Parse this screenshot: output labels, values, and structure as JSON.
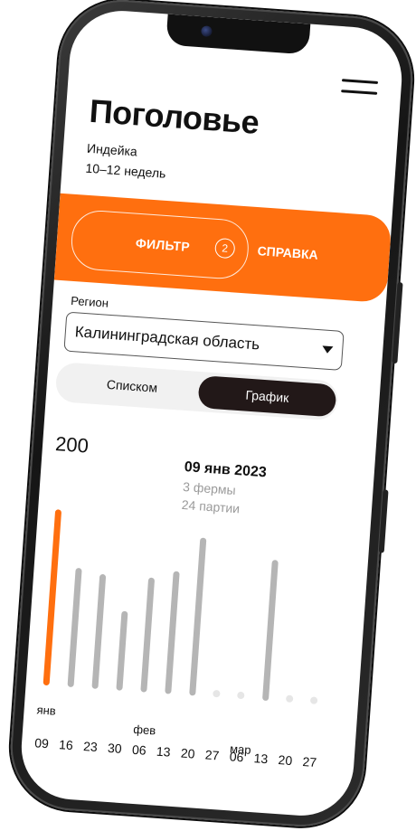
{
  "page": {
    "title": "Поголовье",
    "animal": "Индейка",
    "age": "10–12 недель"
  },
  "tabs": {
    "filter_label": "ФИЛЬТР",
    "filter_count": "2",
    "help_label": "СПРАВКА"
  },
  "region": {
    "label": "Регион",
    "value": "Калининградская область"
  },
  "view_toggle": {
    "list_label": "Списком",
    "chart_label": "График",
    "active": "График"
  },
  "selected_info": {
    "date": "09 янв 2023",
    "farms": "3 фермы",
    "parties": "24 партии"
  },
  "colors": {
    "accent": "#ff6f0f",
    "bar": "#b5b5b5",
    "dot": "#e6e6e6",
    "dark": "#221818"
  },
  "chart_data": {
    "type": "bar",
    "ymax_label": "200",
    "ylim": [
      0,
      200
    ],
    "categories": [
      "09",
      "16",
      "23",
      "30",
      "06",
      "13",
      "20",
      "27",
      "06",
      "13",
      "20",
      "27"
    ],
    "months": [
      {
        "label": "янв",
        "start_index": 0
      },
      {
        "label": "фев",
        "start_index": 4
      },
      {
        "label": "мар",
        "start_index": 8
      }
    ],
    "values": [
      200,
      135,
      130,
      90,
      130,
      140,
      180,
      0,
      0,
      160,
      0,
      0
    ],
    "selected_index": 0
  }
}
